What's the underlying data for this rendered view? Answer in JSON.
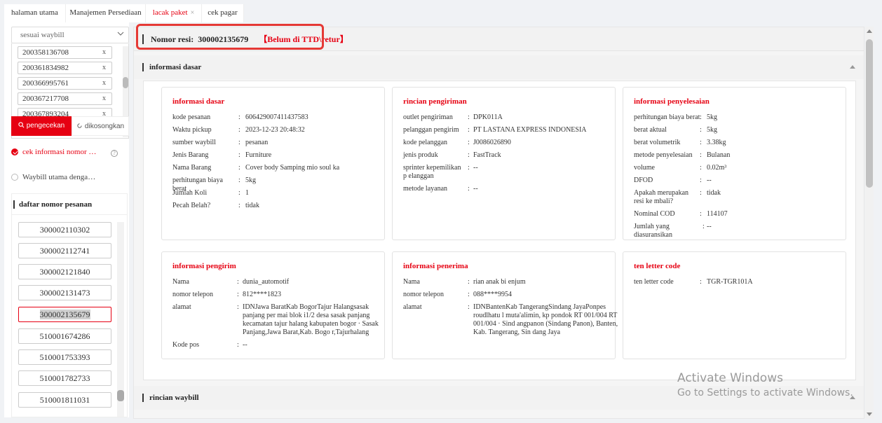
{
  "tabs": [
    {
      "label": "halaman utama",
      "active": false
    },
    {
      "label": "Manajemen Persediaan",
      "active": false
    },
    {
      "label": "lacak paket",
      "active": true,
      "close": "×"
    },
    {
      "label": "cek pagar",
      "active": false
    }
  ],
  "sidebar": {
    "select_value": "sesuai waybill",
    "waybills": [
      {
        "value": "200358136708",
        "remove": "x"
      },
      {
        "value": "200361834982",
        "remove": "x"
      },
      {
        "value": "200366995761",
        "remove": "x"
      },
      {
        "value": "200367217708",
        "remove": "x"
      },
      {
        "value": "200367893204",
        "remove": "x"
      }
    ],
    "search_label": "pengecekan",
    "clear_label": "dikosongkan",
    "option1_label": "cek informasi nomor …",
    "option2_label": "Waybill utama denga…",
    "help_glyph": "?",
    "order_title": "daftar nomor pesanan",
    "orders": [
      "300002110302",
      "300002112741",
      "300002121840",
      "300002131473",
      "300002135679",
      "510001674286",
      "510001753393",
      "510001782733",
      "510001811031"
    ],
    "selected_order_index": 4
  },
  "resi": {
    "label": "Nomor resi:",
    "number": "300002135679",
    "status": "【Belum di TTD\\retur】"
  },
  "sections": {
    "basic": "informasi dasar",
    "waybill": "rincian waybill"
  },
  "cards": {
    "basic": {
      "title": "informasi dasar",
      "rows": [
        {
          "k": "kode pesanan",
          "v": "606429007411437583"
        },
        {
          "k": "Waktu pickup",
          "v": "2023-12-23 20:48:32"
        },
        {
          "k": "sumber waybill",
          "v": "pesanan"
        },
        {
          "k": "Jenis Barang",
          "v": "Furniture"
        },
        {
          "k": "Nama Barang",
          "v": "Cover body Samping mio soul ka"
        },
        {
          "k": "perhitungan biaya berat",
          "v": "5kg"
        },
        {
          "k": "Jumlah Koli",
          "v": "1"
        },
        {
          "k": "Pecah Belah?",
          "v": "tidak"
        }
      ]
    },
    "shipping": {
      "title": "rincian pengiriman",
      "rows": [
        {
          "k": "outlet pengiriman",
          "v": "DPK011A"
        },
        {
          "k": "pelanggan pengirim",
          "v": "PT LASTANA EXPRESS INDONESIA"
        },
        {
          "k": "kode pelanggan",
          "v": "J0086026890"
        },
        {
          "k": "jenis produk",
          "v": "FastTrack"
        },
        {
          "k": "sprinter kepemilikan p elanggan",
          "v": "--"
        },
        {
          "k": "metode layanan",
          "v": "--"
        }
      ]
    },
    "settlement": {
      "title": "informasi penyelesaian",
      "rows": [
        {
          "k": "perhitungan biaya berat",
          "v": "5kg"
        },
        {
          "k": "berat aktual",
          "v": "5kg"
        },
        {
          "k": "berat volumetrik",
          "v": "3.38kg"
        },
        {
          "k": "metode penyelesaian",
          "v": "Bulanan"
        },
        {
          "k": "volume",
          "v": "0.02m³"
        },
        {
          "k": "DFOD",
          "v": "--"
        },
        {
          "k": "Apakah merupakan resi ke mbali?",
          "v": "tidak"
        },
        {
          "k": "Nominal COD",
          "v": "114107"
        },
        {
          "k": "Jumlah yang diasuransikan",
          "v": "--"
        }
      ]
    },
    "sender": {
      "title": "informasi pengirim",
      "rows": [
        {
          "k": "Nama",
          "v": "dunia_automotif"
        },
        {
          "k": "nomor telepon",
          "v": "812****1823"
        },
        {
          "k": "alamat",
          "v": "IDNJawa BaratKab BogorTajur Halangsasak panjang per mai blok i1/2 desa sasak panjang kecamatan tajur halang kabupaten bogor · Sasak Panjang,Jawa Barat,Kab. Bogo r,Tajurhalang"
        },
        {
          "k": "Kode pos",
          "v": "--"
        }
      ]
    },
    "receiver": {
      "title": "informasi penerima",
      "rows": [
        {
          "k": "Nama",
          "v": "rian anak bi enjum"
        },
        {
          "k": "nomor telepon",
          "v": "088****9954"
        },
        {
          "k": "alamat",
          "v": "IDNBantenKab TangerangSindang JayaPonpes roudlhatu l muta'alimin, kp pondok RT 001/004 RT 001/004 · Sind angpanon (Sindang Panon), Banten, Kab. Tangerang, Sin dang Jaya"
        }
      ]
    },
    "tlc": {
      "title": "ten letter code",
      "rows": [
        {
          "k": "ten letter code",
          "v": "TGR-TGR101A"
        }
      ]
    }
  },
  "watermark": {
    "line1": "Activate Windows",
    "line2": "Go to Settings to activate Windows."
  },
  "colors": {
    "accent": "#e60012",
    "highlight": "#e53935"
  }
}
